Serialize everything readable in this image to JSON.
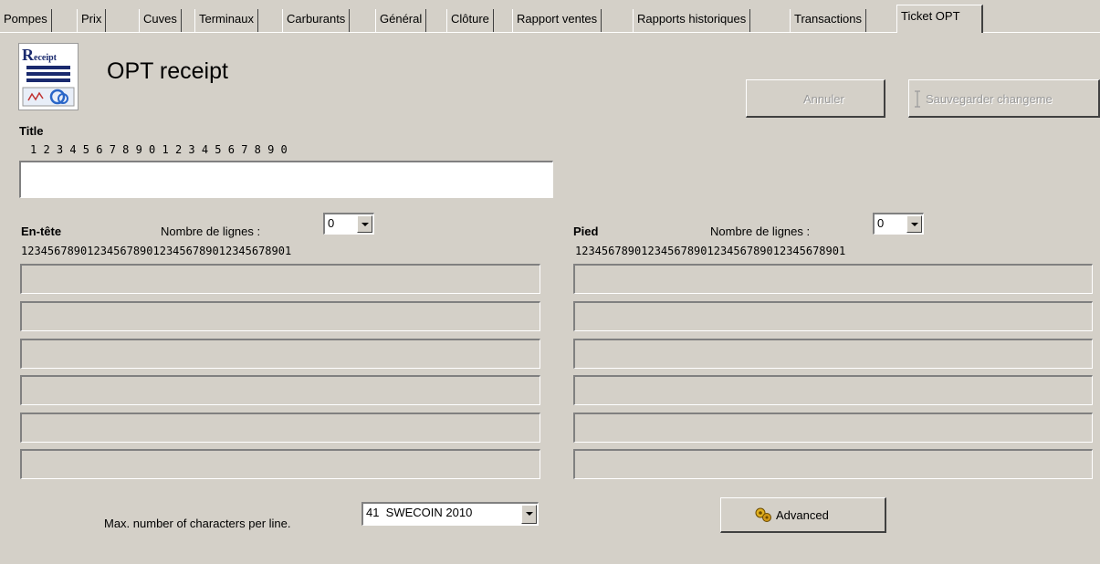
{
  "tabs": [
    {
      "label": "Pompes"
    },
    {
      "label": "Prix"
    },
    {
      "label": "Cuves"
    },
    {
      "label": "Terminaux"
    },
    {
      "label": "Carburants"
    },
    {
      "label": "Général"
    },
    {
      "label": "Clôture"
    },
    {
      "label": "Rapport ventes"
    },
    {
      "label": "Rapports historiques"
    },
    {
      "label": "Transactions"
    },
    {
      "label": "Ticket OPT",
      "active": true
    }
  ],
  "header": {
    "logo_text": "Receipt",
    "title": "OPT receipt",
    "cancel_label": "Annuler",
    "save_label": "Sauvegarder changeme"
  },
  "title_section": {
    "label": "Title",
    "ruler": "1 2 3 4 5 6 7 8 9 0 1 2 3 4 5 6 7 8 9 0",
    "value": ""
  },
  "header_section": {
    "label": "En-tête",
    "lines_label": "Nombre de lignes :",
    "lines_value": "0",
    "ruler": "12345678901234567890123456789012345678901",
    "lines": [
      "",
      "",
      "",
      "",
      "",
      ""
    ]
  },
  "footer_section": {
    "label": "Pied",
    "lines_label": "Nombre de lignes :",
    "lines_value": "0",
    "ruler": "12345678901234567890123456789012345678901",
    "lines": [
      "",
      "",
      "",
      "",
      "",
      ""
    ]
  },
  "bottom": {
    "max_chars_label": "Max. number of characters per line.",
    "max_chars_value": "41  SWECOIN 2010",
    "advanced_label": "Advanced"
  },
  "colors": {
    "window_bg": "#d4d0c8",
    "disabled_text": "#9a9a9a"
  }
}
